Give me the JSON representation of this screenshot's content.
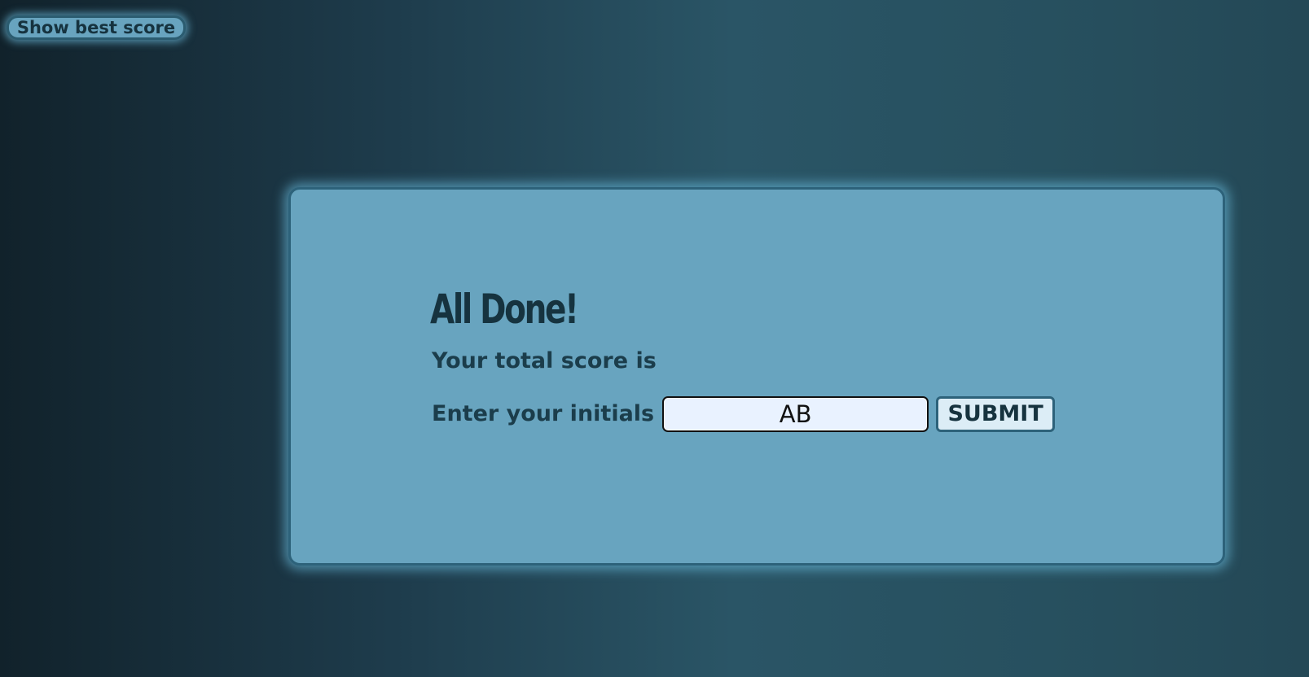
{
  "header": {
    "best_score_label": "Show best score"
  },
  "quiz_end": {
    "title": "All Done!",
    "score_text": "Your total score is",
    "initials_label": "Enter your initials",
    "initials_value": "AB",
    "submit_label": "SUBMIT"
  },
  "colors": {
    "card_background": "#68a4bf",
    "card_border": "#2d627a",
    "text_dark": "#16333f",
    "input_background": "#e9f2ff",
    "button_background": "#dcedf6"
  }
}
